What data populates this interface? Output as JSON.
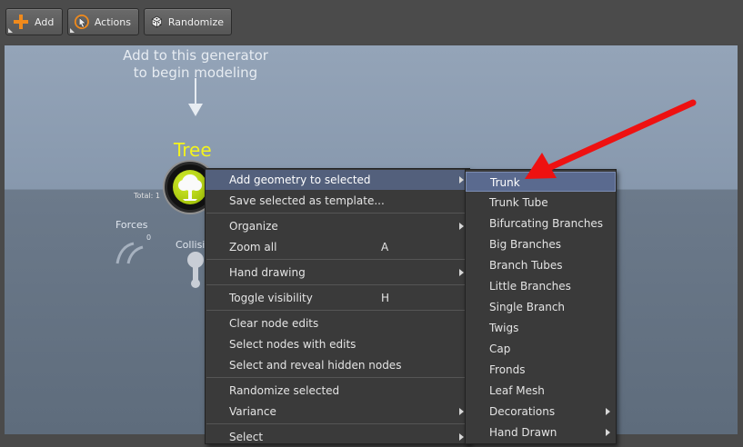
{
  "toolbar": {
    "buttons": [
      {
        "label": "Add",
        "icon": "plus-icon"
      },
      {
        "label": "Actions",
        "icon": "cursor-icon"
      },
      {
        "label": "Randomize",
        "icon": "dice-icon"
      }
    ]
  },
  "canvas": {
    "hint_line1": "Add to this generator",
    "hint_line2": "to begin modeling",
    "node_title": "Tree",
    "total_label": "Total: 1",
    "forces_label": "Forces",
    "forces_count": "0",
    "collision_label": "Collisi"
  },
  "context_menu": {
    "items": [
      {
        "label": "Add geometry to selected",
        "submenu": true,
        "highlighted": true
      },
      {
        "label": "Save selected as template..."
      },
      {
        "label": "Organize",
        "submenu": true
      },
      {
        "label": "Zoom all",
        "shortcut": "A"
      },
      {
        "label": "Hand drawing",
        "submenu": true
      },
      {
        "label": "Toggle visibility",
        "shortcut": "H"
      },
      {
        "label": "Clear node edits"
      },
      {
        "label": "Select nodes with edits"
      },
      {
        "label": "Select and reveal hidden nodes"
      },
      {
        "label": "Randomize selected"
      },
      {
        "label": "Variance",
        "submenu": true
      },
      {
        "label": "Select",
        "submenu": true
      }
    ]
  },
  "submenu": {
    "items": [
      {
        "label": "Trunk",
        "highlighted": true
      },
      {
        "label": "Trunk Tube"
      },
      {
        "label": "Bifurcating Branches"
      },
      {
        "label": "Big Branches"
      },
      {
        "label": "Branch Tubes"
      },
      {
        "label": "Little Branches"
      },
      {
        "label": "Single Branch"
      },
      {
        "label": "Twigs"
      },
      {
        "label": "Cap"
      },
      {
        "label": "Fronds"
      },
      {
        "label": "Leaf Mesh"
      },
      {
        "label": "Decorations",
        "submenu": true
      },
      {
        "label": "Hand Drawn",
        "submenu": true
      }
    ]
  },
  "colors": {
    "annotation_arrow": "#ee1111",
    "node_title": "#f4f41c",
    "menu_highlight": "#53607c"
  }
}
